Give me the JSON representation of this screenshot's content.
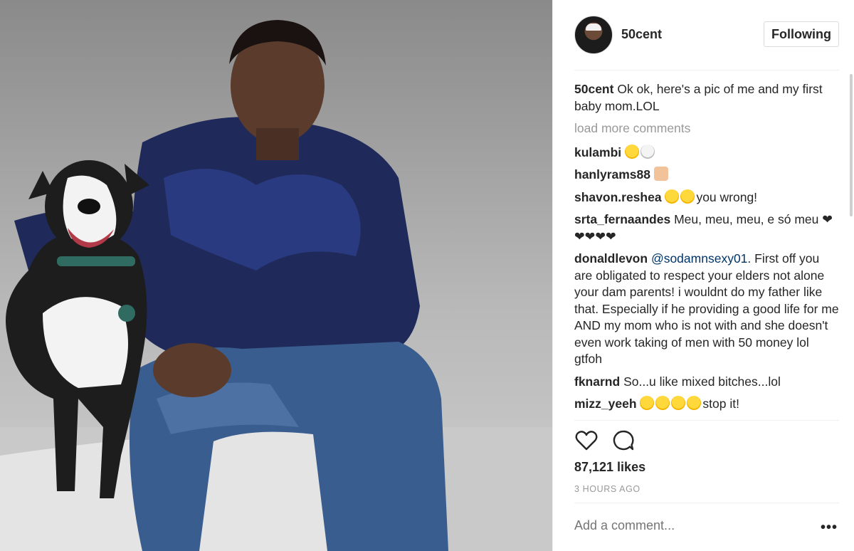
{
  "post": {
    "author": "50cent",
    "follow_label": "Following",
    "caption": {
      "user": "50cent",
      "text": "Ok ok, here's a pic of me and my first baby mom.LOL"
    },
    "load_more_label": "load more comments",
    "comments": [
      {
        "user": "kulambi",
        "text": "",
        "emojis": [
          "laughing-crying",
          "skull"
        ]
      },
      {
        "user": "hanlyrams88",
        "text": "",
        "emojis": [
          "thumbs-down"
        ]
      },
      {
        "user": "shavon.reshea",
        "text": "you wrong!",
        "emojis": [
          "laughing-crying",
          "laughing-crying"
        ]
      },
      {
        "user": "srta_fernaandes",
        "text": "Meu, meu, meu, e só meu ❤❤❤❤❤",
        "emojis": []
      },
      {
        "user": "donaldlevon",
        "mention": "@sodamnsexy01",
        "text": ". First off you are obligated to respect your elders not alone your dam parents! i wouldnt do my father like that. Especially if he providing a good life for me AND my mom who is not with and she doesn't even work taking of men with 50 money lol gtfoh",
        "emojis": []
      },
      {
        "user": "fknarnd",
        "text": "So...u like mixed bitches...lol",
        "emojis": []
      },
      {
        "user": "mizz_yeeh",
        "text": "stop it!",
        "emojis": [
          "laughing-crying",
          "laughing-crying",
          "laughing-crying",
          "laughing-crying"
        ]
      }
    ],
    "likes": "87,121 likes",
    "timestamp": "3 HOURS AGO",
    "add_comment_placeholder": "Add a comment...",
    "more_label": "•••",
    "icons": {
      "like": "heart-outline-icon",
      "comment": "speech-bubble-icon"
    },
    "colors": {
      "text": "#262626",
      "muted": "#999999",
      "mention": "#003569",
      "border": "#dbdbdb"
    }
  }
}
